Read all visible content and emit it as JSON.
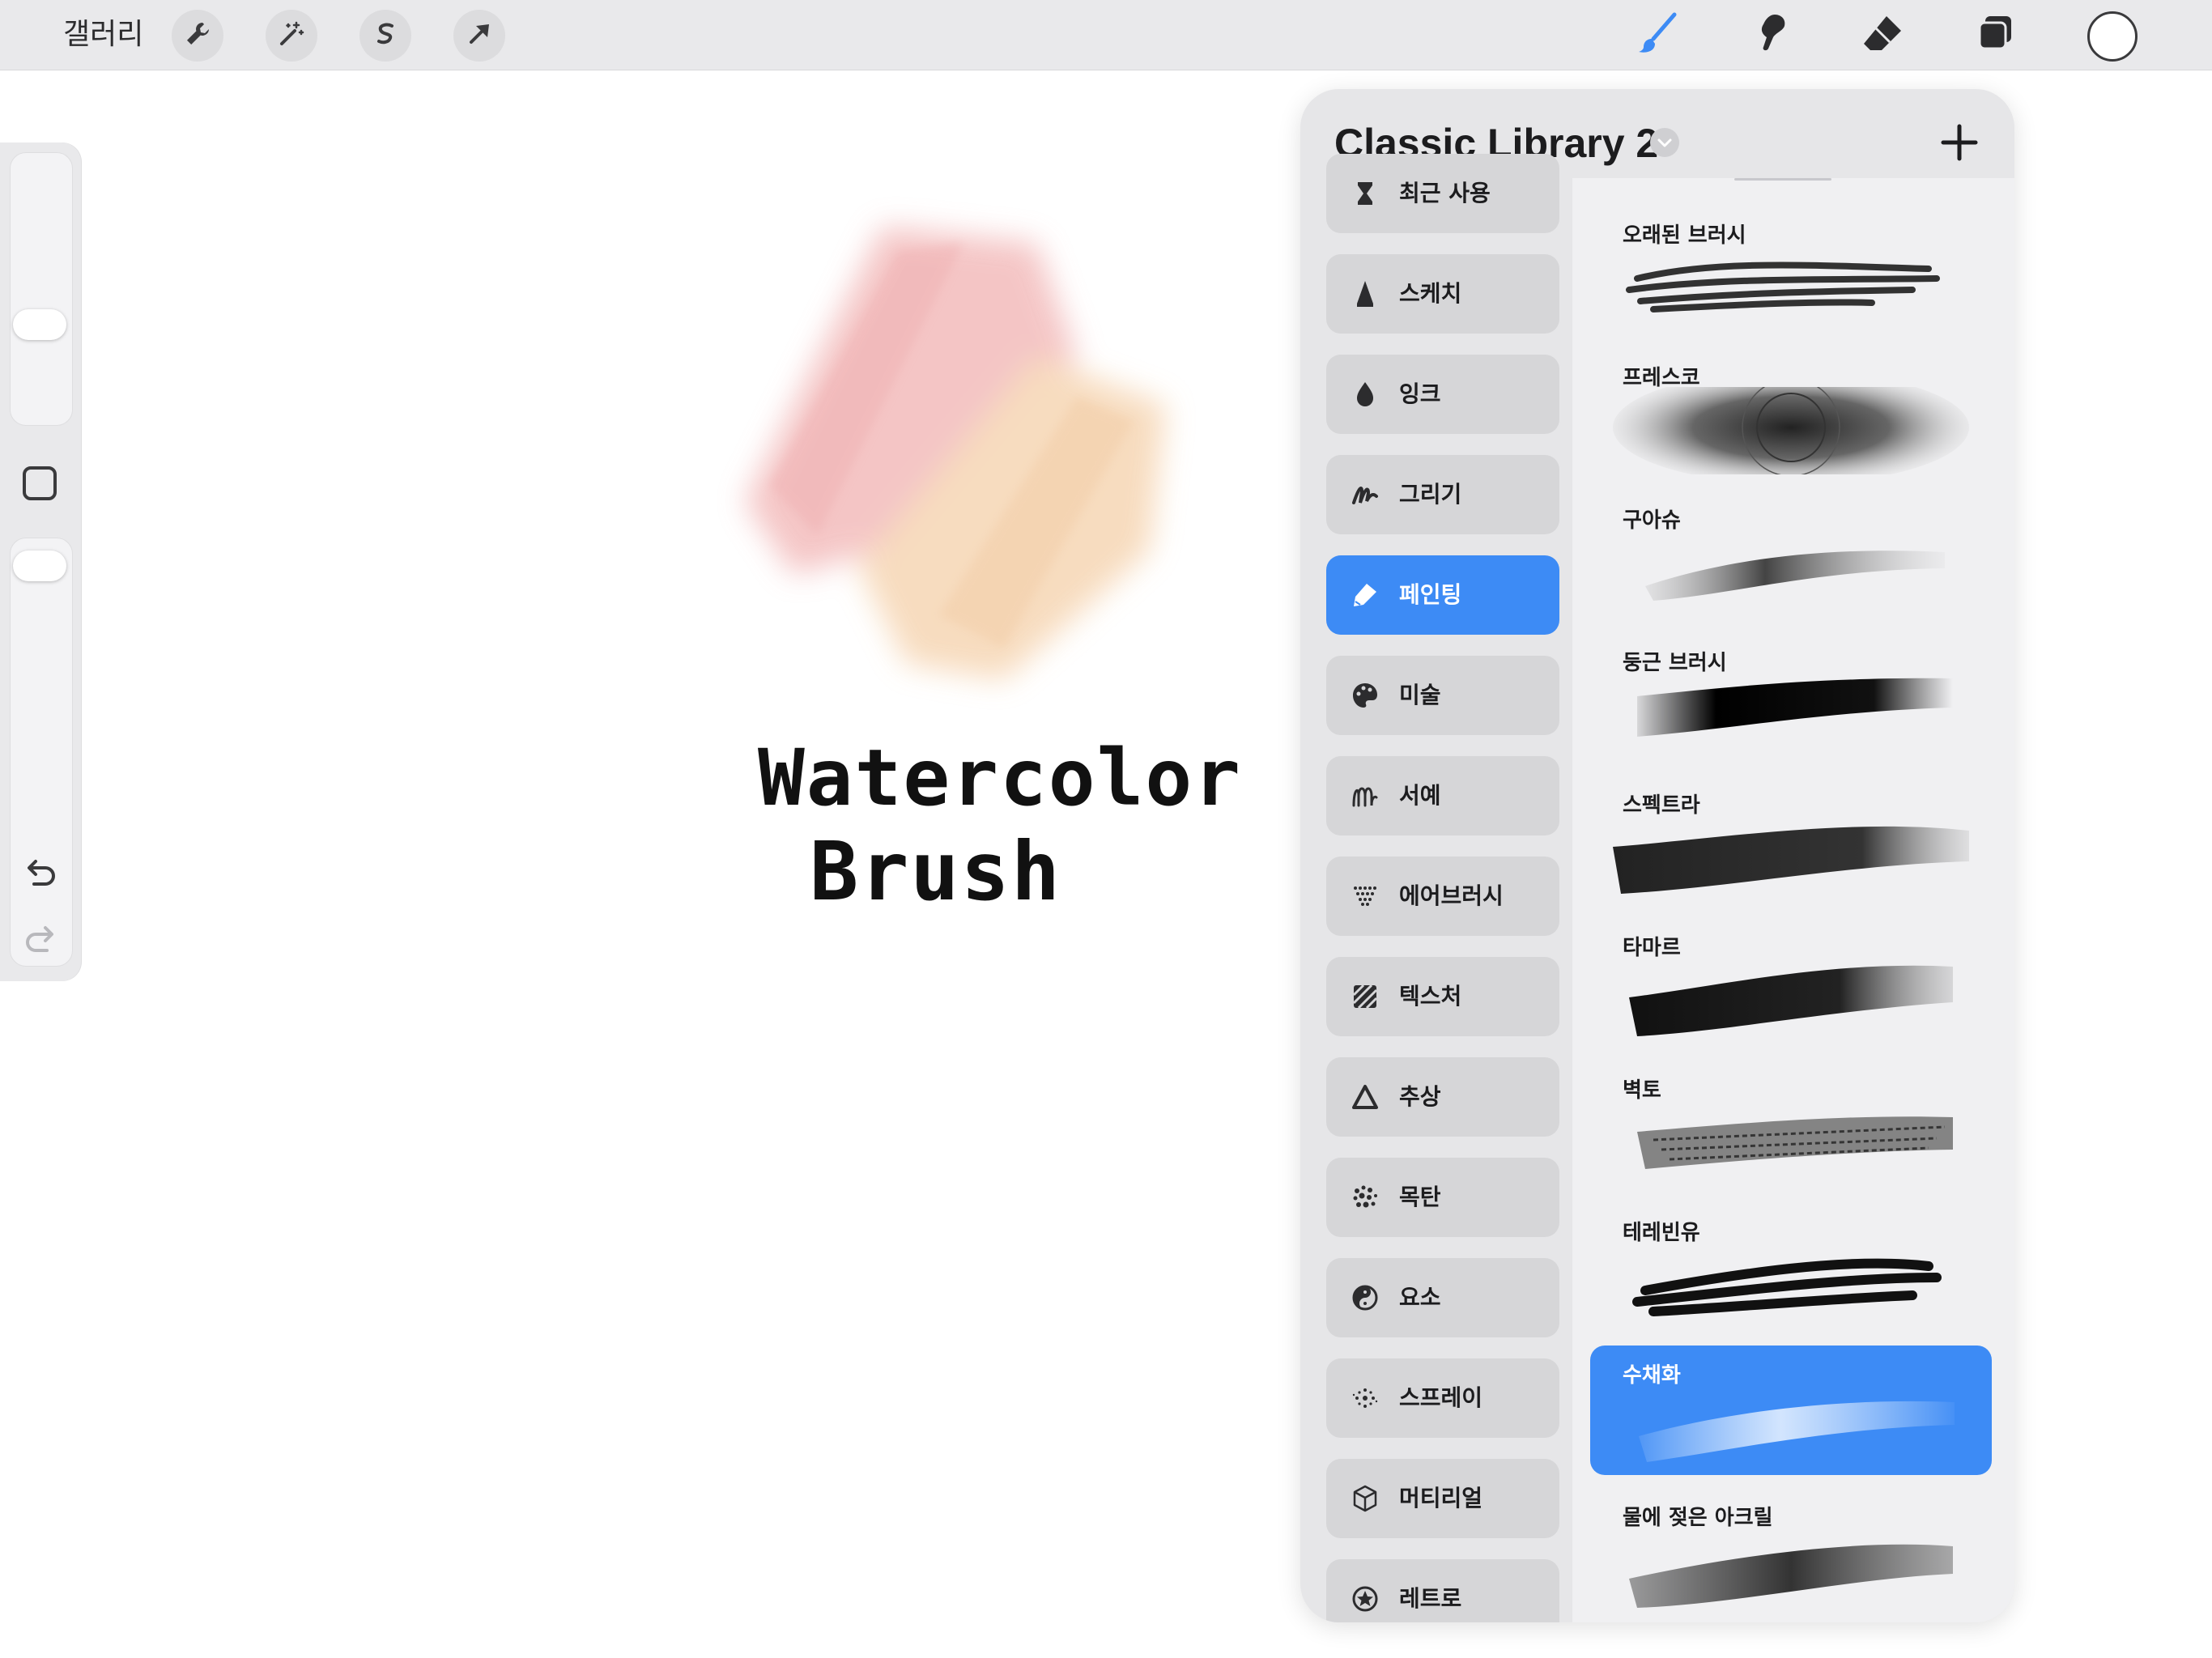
{
  "toolbar": {
    "gallery_label": "갤러리",
    "left_tools": [
      "wrench-icon",
      "magic-wand-icon",
      "selection-icon",
      "transform-arrow-icon"
    ],
    "right_tools": [
      "brush-icon",
      "smudge-icon",
      "eraser-icon",
      "layers-icon"
    ],
    "current_color": "#ffffff",
    "active_tool_color": "#3d8bf5"
  },
  "sidebar": {
    "controls": [
      "brush-size-slider",
      "modify-square",
      "opacity-slider",
      "undo-icon",
      "redo-icon"
    ]
  },
  "canvas": {
    "text_line1": "Watercolor",
    "text_line2": "Brush",
    "wash_colors": [
      "#f3bcbc",
      "#f6d6b4"
    ]
  },
  "library": {
    "title": "Classic Library 2",
    "categories": [
      {
        "label": "최근 사용",
        "icon": "hourglass-icon"
      },
      {
        "label": "스케치",
        "icon": "pencil-tip-icon"
      },
      {
        "label": "잉크",
        "icon": "ink-drop-icon"
      },
      {
        "label": "그리기",
        "icon": "scribble-icon"
      },
      {
        "label": "페인팅",
        "icon": "paint-brush-icon",
        "active": true
      },
      {
        "label": "미술",
        "icon": "palette-icon"
      },
      {
        "label": "서예",
        "icon": "calligraphy-icon"
      },
      {
        "label": "에어브러시",
        "icon": "airbrush-icon"
      },
      {
        "label": "텍스처",
        "icon": "texture-icon"
      },
      {
        "label": "추상",
        "icon": "triangle-icon"
      },
      {
        "label": "목탄",
        "icon": "charcoal-dots-icon"
      },
      {
        "label": "요소",
        "icon": "yin-yang-icon"
      },
      {
        "label": "스프레이",
        "icon": "spray-icon"
      },
      {
        "label": "머티리얼",
        "icon": "cube-icon"
      },
      {
        "label": "레트로",
        "icon": "star-circle-icon"
      }
    ],
    "brushes": [
      {
        "name": "오래된 브러시"
      },
      {
        "name": "프레스코"
      },
      {
        "name": "구아슈"
      },
      {
        "name": "둥근 브러시"
      },
      {
        "name": "스펙트라"
      },
      {
        "name": "타마르"
      },
      {
        "name": "벽토"
      },
      {
        "name": "테레빈유"
      },
      {
        "name": "수채화",
        "active": true
      },
      {
        "name": "물에 젖은 아크릴"
      }
    ]
  }
}
